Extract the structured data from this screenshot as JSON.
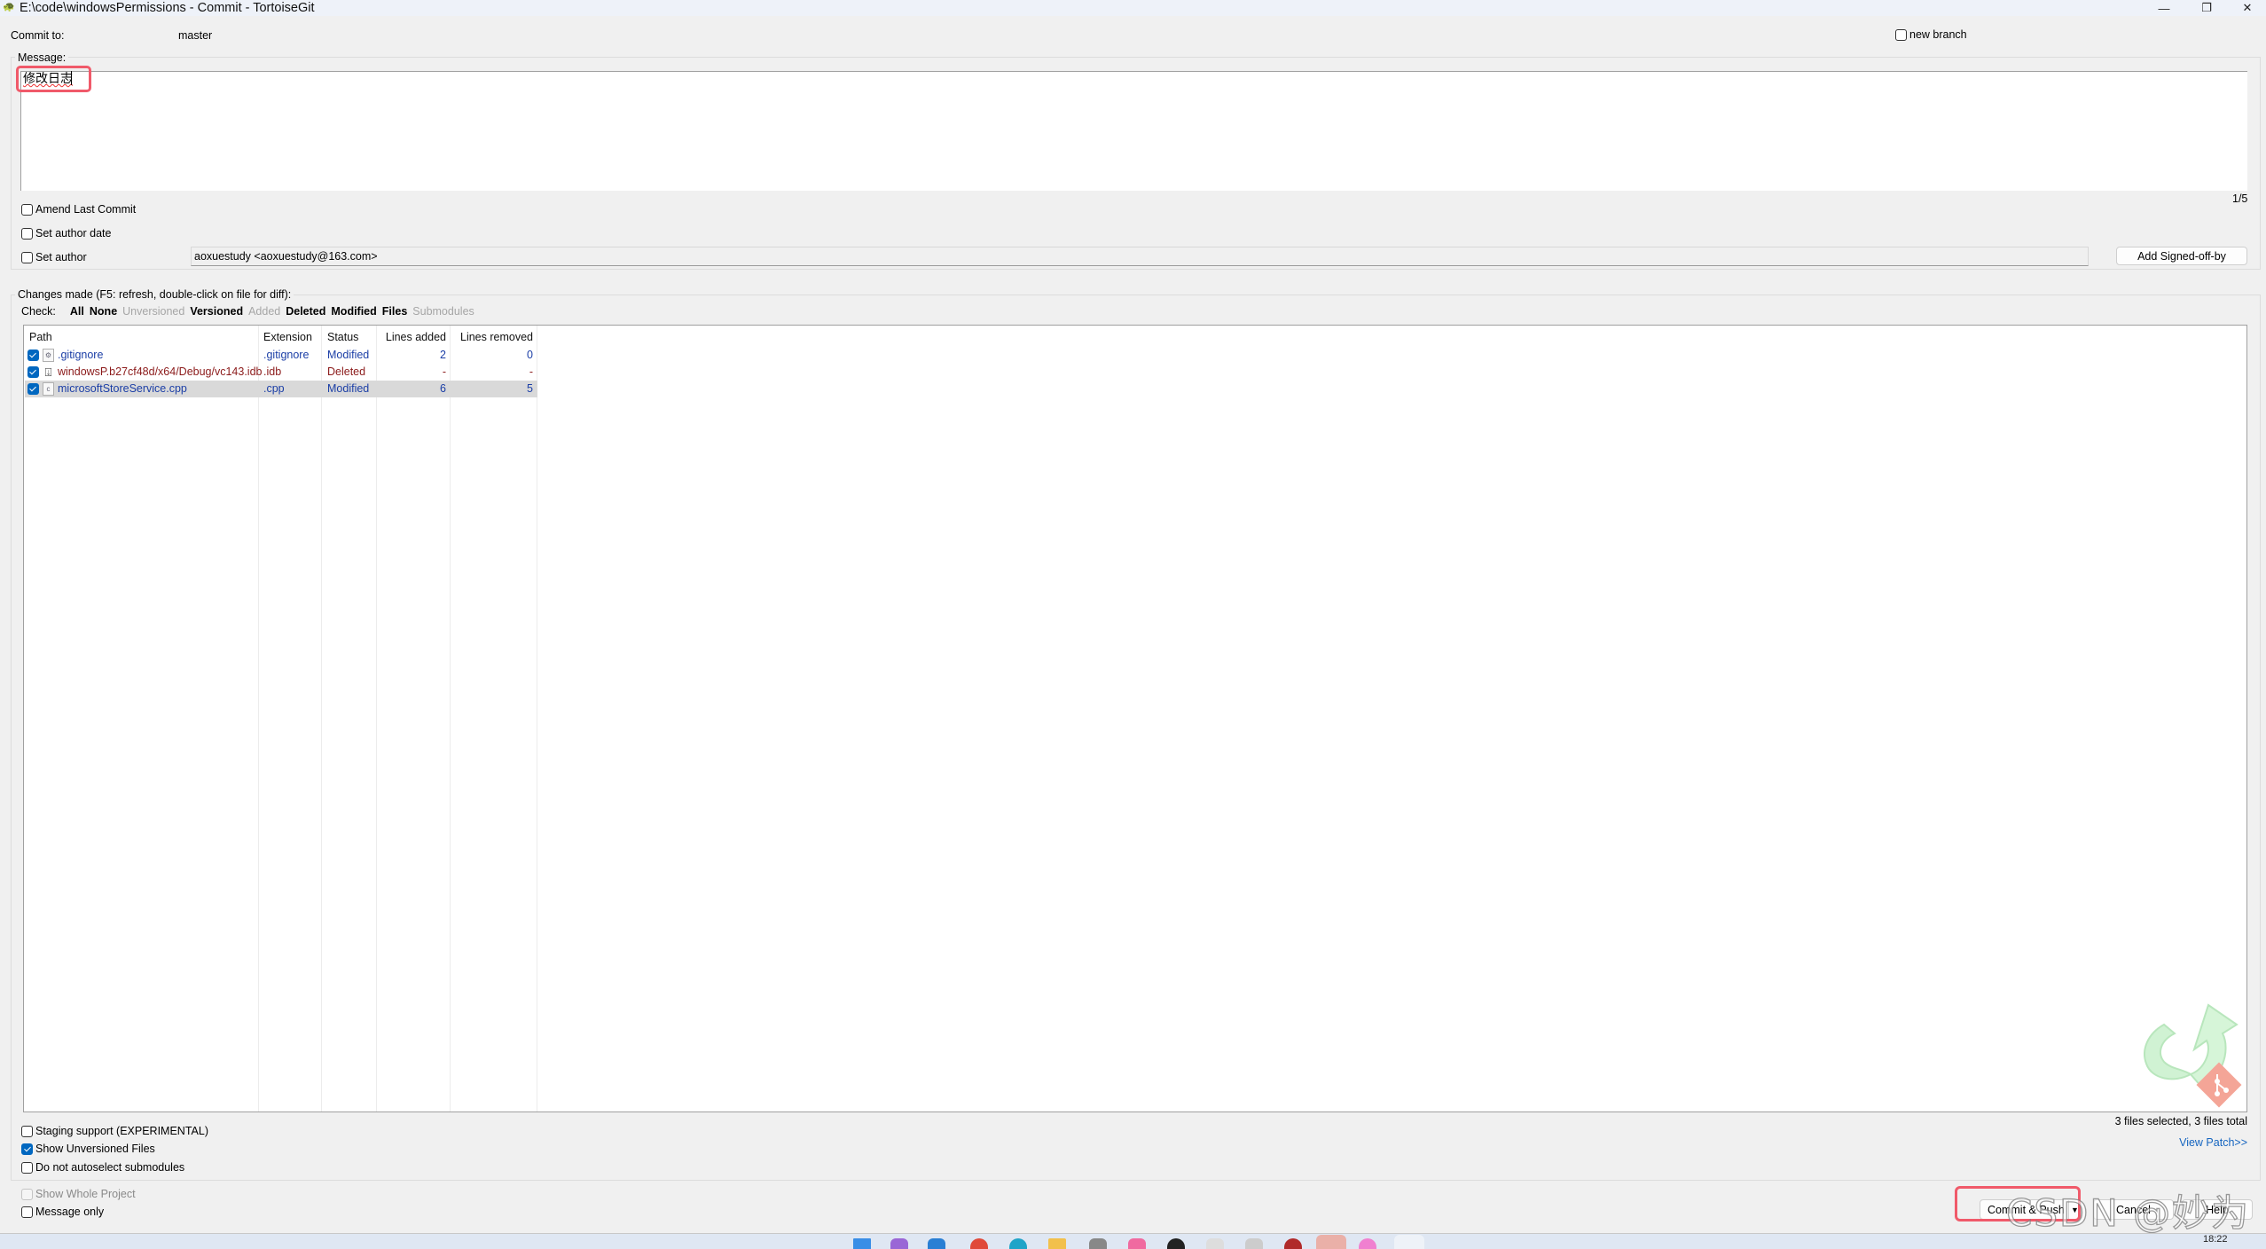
{
  "window": {
    "title": "E:\\code\\windowsPermissions - Commit - TortoiseGit",
    "app_icon": "tortoisegit-icon",
    "controls": {
      "minimize": "—",
      "maximize": "❐",
      "close": "✕"
    }
  },
  "header": {
    "commit_to_label": "Commit to:",
    "branch": "master",
    "new_branch_label": "new branch",
    "new_branch_checked": false
  },
  "message": {
    "group_label": "Message:",
    "text": "修改日志",
    "counter": "1/5",
    "amend_label": "Amend Last Commit",
    "set_author_date_label": "Set author date",
    "set_author_label": "Set author",
    "author_value": "aoxuestudy <aoxuestudy@163.com>",
    "signoff_button": "Add Signed-off-by"
  },
  "changes": {
    "group_label": "Changes made (F5: refresh, double-click on file for diff):",
    "check_label": "Check:",
    "check_filters": [
      {
        "label": "All",
        "enabled": true
      },
      {
        "label": "None",
        "enabled": true
      },
      {
        "label": "Unversioned",
        "enabled": false
      },
      {
        "label": "Versioned",
        "enabled": true
      },
      {
        "label": "Added",
        "enabled": false
      },
      {
        "label": "Deleted",
        "enabled": true
      },
      {
        "label": "Modified",
        "enabled": true
      },
      {
        "label": "Files",
        "enabled": true
      },
      {
        "label": "Submodules",
        "enabled": false
      }
    ],
    "columns": [
      "Path",
      "Extension",
      "Status",
      "Lines added",
      "Lines removed"
    ],
    "files": [
      {
        "checked": true,
        "icon": "text-file-icon",
        "path": ".gitignore",
        "extension": ".gitignore",
        "status": "Modified",
        "lines_added": "2",
        "lines_removed": "0",
        "selected": false
      },
      {
        "checked": true,
        "icon": "deleted-file-icon",
        "path": "windowsP.b27cf48d/x64/Debug/vc143.idb",
        "extension": ".idb",
        "status": "Deleted",
        "lines_added": "-",
        "lines_removed": "-",
        "selected": false
      },
      {
        "checked": true,
        "icon": "cpp-file-icon",
        "path": "microsoftStoreService.cpp",
        "extension": ".cpp",
        "status": "Modified",
        "lines_added": "6",
        "lines_removed": "5",
        "selected": true
      }
    ],
    "status_text": "3 files selected, 3 files total",
    "view_patch": "View Patch>>"
  },
  "options": {
    "staging": {
      "label": "Staging support (EXPERIMENTAL)",
      "checked": false
    },
    "show_unversioned": {
      "label": "Show Unversioned Files",
      "checked": true
    },
    "no_autoselect": {
      "label": "Do not autoselect submodules",
      "checked": false
    },
    "whole_project": {
      "label": "Show Whole Project",
      "checked": false,
      "disabled": true
    },
    "message_only": {
      "label": "Message only",
      "checked": false
    }
  },
  "buttons": {
    "commit": "Commit & Push",
    "cancel": "Cancel",
    "help": "Help"
  },
  "watermark": "CSDN @妙为",
  "taskbar": {
    "clock": "18:22"
  },
  "colors": {
    "modified": "#1b3ea6",
    "deleted": "#8b1a1a",
    "highlight": "#f05a6a",
    "link": "#1565c0",
    "checkbox": "#0067c0"
  }
}
